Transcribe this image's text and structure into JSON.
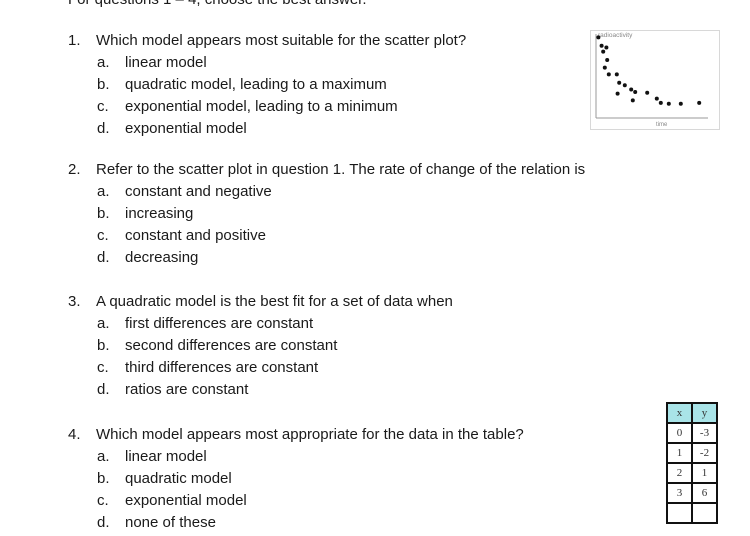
{
  "header": {
    "instruction": "For questions 1 – 4, choose the best answer."
  },
  "questions": [
    {
      "number": "1.",
      "text": "Which model appears most suitable for the scatter plot?",
      "options": [
        {
          "letter": "a.",
          "text": "linear model"
        },
        {
          "letter": "b.",
          "text": "quadratic model, leading to a maximum"
        },
        {
          "letter": "c.",
          "text": "exponential model, leading to a minimum"
        },
        {
          "letter": "d.",
          "text": "exponential model"
        }
      ]
    },
    {
      "number": "2.",
      "text": "Refer to the scatter plot in question 1.  The rate of change of the relation is",
      "options": [
        {
          "letter": "a.",
          "text": "constant and negative"
        },
        {
          "letter": "b.",
          "text": "increasing"
        },
        {
          "letter": "c.",
          "text": "constant and positive"
        },
        {
          "letter": "d.",
          "text": "decreasing"
        }
      ]
    },
    {
      "number": "3.",
      "text": "A quadratic model is the best fit for a set of data when",
      "options": [
        {
          "letter": "a.",
          "text": "first differences are constant"
        },
        {
          "letter": "b.",
          "text": "second differences are constant"
        },
        {
          "letter": "c.",
          "text": "third differences are constant"
        },
        {
          "letter": "d.",
          "text": "ratios are constant"
        }
      ]
    },
    {
      "number": "4.",
      "text": "Which model appears most appropriate for the data in the table?",
      "options": [
        {
          "letter": "a.",
          "text": "linear model"
        },
        {
          "letter": "b.",
          "text": "quadratic model"
        },
        {
          "letter": "c.",
          "text": "exponential model"
        },
        {
          "letter": "d.",
          "text": "none of these"
        }
      ]
    }
  ],
  "scatter_plot": {
    "ylabel": "radioactivity",
    "xlabel": "time",
    "points": [
      [
        0.3,
        9.6
      ],
      [
        0.7,
        8.6
      ],
      [
        1.3,
        8.4
      ],
      [
        0.9,
        7.9
      ],
      [
        1.4,
        6.9
      ],
      [
        1.1,
        6.0
      ],
      [
        1.6,
        5.2
      ],
      [
        2.6,
        5.2
      ],
      [
        2.9,
        4.2
      ],
      [
        3.6,
        3.9
      ],
      [
        4.4,
        3.4
      ],
      [
        2.7,
        2.9
      ],
      [
        4.9,
        3.1
      ],
      [
        6.4,
        3.0
      ],
      [
        4.6,
        2.1
      ],
      [
        7.6,
        2.3
      ],
      [
        8.1,
        1.8
      ],
      [
        9.1,
        1.7
      ],
      [
        10.6,
        1.7
      ],
      [
        12.9,
        1.8
      ]
    ]
  },
  "table": {
    "headers": [
      "x",
      "y"
    ],
    "rows": [
      [
        "0",
        "-3"
      ],
      [
        "1",
        "-2"
      ],
      [
        "2",
        "1"
      ],
      [
        "3",
        "6"
      ],
      [
        "",
        ""
      ]
    ]
  }
}
